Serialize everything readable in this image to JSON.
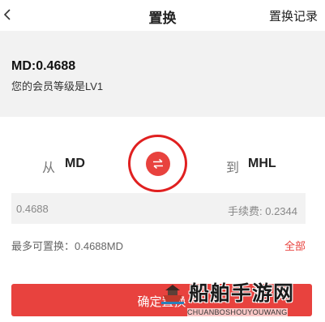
{
  "header": {
    "title": "置换",
    "right_link": "置换记录"
  },
  "member": {
    "balance": "MD:0.4688",
    "level_text": "您的会员等级是LV1"
  },
  "exchange": {
    "from_label": "从",
    "from_currency": "MD",
    "to_label": "到",
    "to_currency": "MHL"
  },
  "amount": {
    "value": "0.4688",
    "fee_text": "手续费: 0.2344"
  },
  "max_text": "最多可置换：0.4688MD",
  "all_label": "全部",
  "confirm_label": "确定置换",
  "watermark": {
    "text": "船舶手游网",
    "subtext": "CHUANBOSHOUYOUWANG"
  },
  "colors": {
    "accent": "#e8423e",
    "highlight_ring": "#e02020",
    "panel_bg": "#f2f2f2"
  },
  "icons": {
    "back": "chevron-left-icon",
    "swap": "swap-arrows-icon",
    "watermark_logo": "ship-logo-icon"
  }
}
